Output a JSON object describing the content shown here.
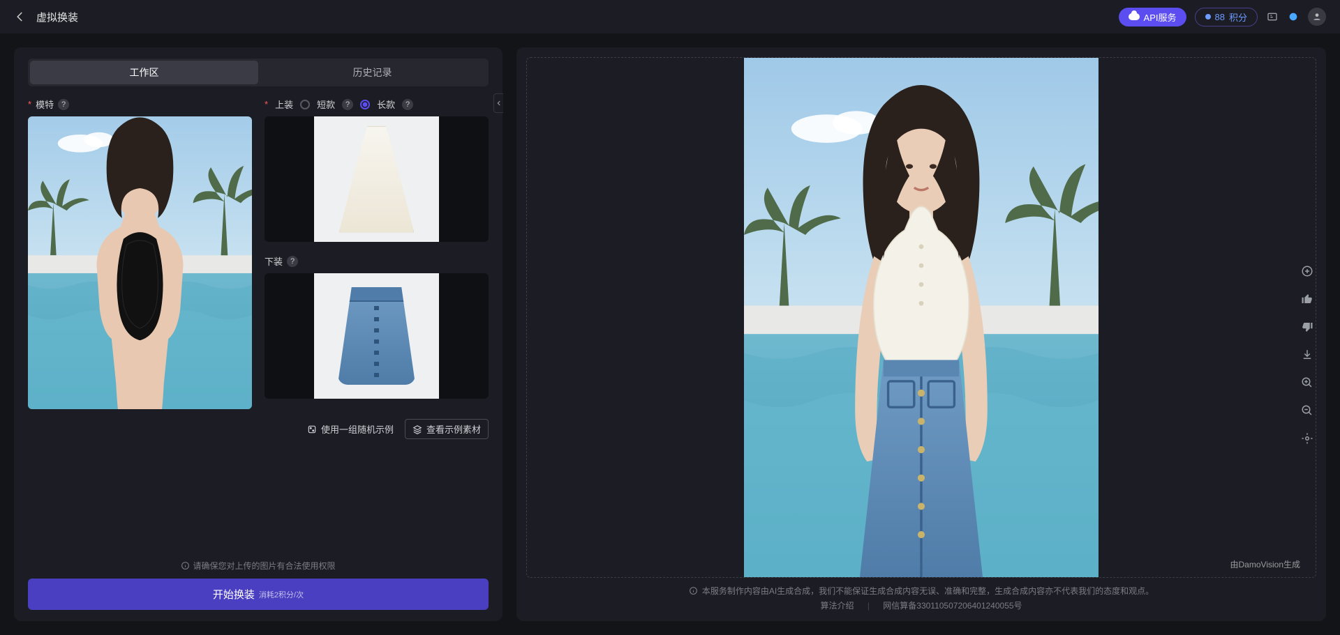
{
  "header": {
    "title": "虚拟换装",
    "api_label": "API服务",
    "credits_value": "88",
    "credits_unit": "积分"
  },
  "tabs": {
    "workspace": "工作区",
    "history": "历史记录"
  },
  "sections": {
    "model_label": "模特",
    "upper_label": "上装",
    "upper_short": "短款",
    "upper_long": "长款",
    "lower_label": "下装"
  },
  "helpers": {
    "random_example": "使用一组随机示例",
    "view_examples": "查看示例素材"
  },
  "legal_hint": "请确保您对上传的图片有合法使用权限",
  "run": {
    "label": "开始换装",
    "cost": "消耗2积分/次"
  },
  "preview": {
    "watermark": "由DamoVision生成"
  },
  "footer": {
    "disclaimer": "本服务制作内容由AI生成合成，我们不能保证生成合成内容无误、准确和完整，生成合成内容亦不代表我们的态度和观点。",
    "algo_link": "算法介绍",
    "record_no": "网信算备330110507206401240055号"
  },
  "tools": {
    "add": "add",
    "like": "like",
    "dislike": "dislike",
    "download": "download",
    "zoom_in": "zoom_in",
    "zoom_out": "zoom_out",
    "locate": "locate"
  }
}
